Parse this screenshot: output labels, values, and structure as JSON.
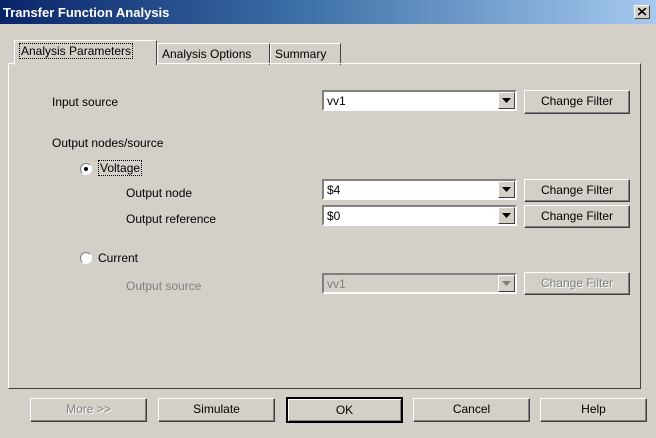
{
  "window": {
    "title": "Transfer Function Analysis"
  },
  "tabs": [
    {
      "label": "Analysis Parameters",
      "active": true
    },
    {
      "label": "Analysis Options",
      "active": false
    },
    {
      "label": "Summary",
      "active": false
    }
  ],
  "input_source": {
    "label": "Input source",
    "value": "vv1",
    "button": "Change Filter"
  },
  "output_section": {
    "label": "Output nodes/source"
  },
  "voltage": {
    "radio_label": "Voltage",
    "selected": true,
    "output_node": {
      "label": "Output node",
      "value": "$4",
      "button": "Change Filter"
    },
    "output_reference": {
      "label": "Output reference",
      "value": "$0",
      "button": "Change Filter"
    }
  },
  "current": {
    "radio_label": "Current",
    "selected": false,
    "output_source": {
      "label": "Output source",
      "value": "vv1",
      "button": "Change Filter"
    }
  },
  "footer": {
    "more": "More >>",
    "simulate": "Simulate",
    "ok": "OK",
    "cancel": "Cancel",
    "help": "Help"
  }
}
